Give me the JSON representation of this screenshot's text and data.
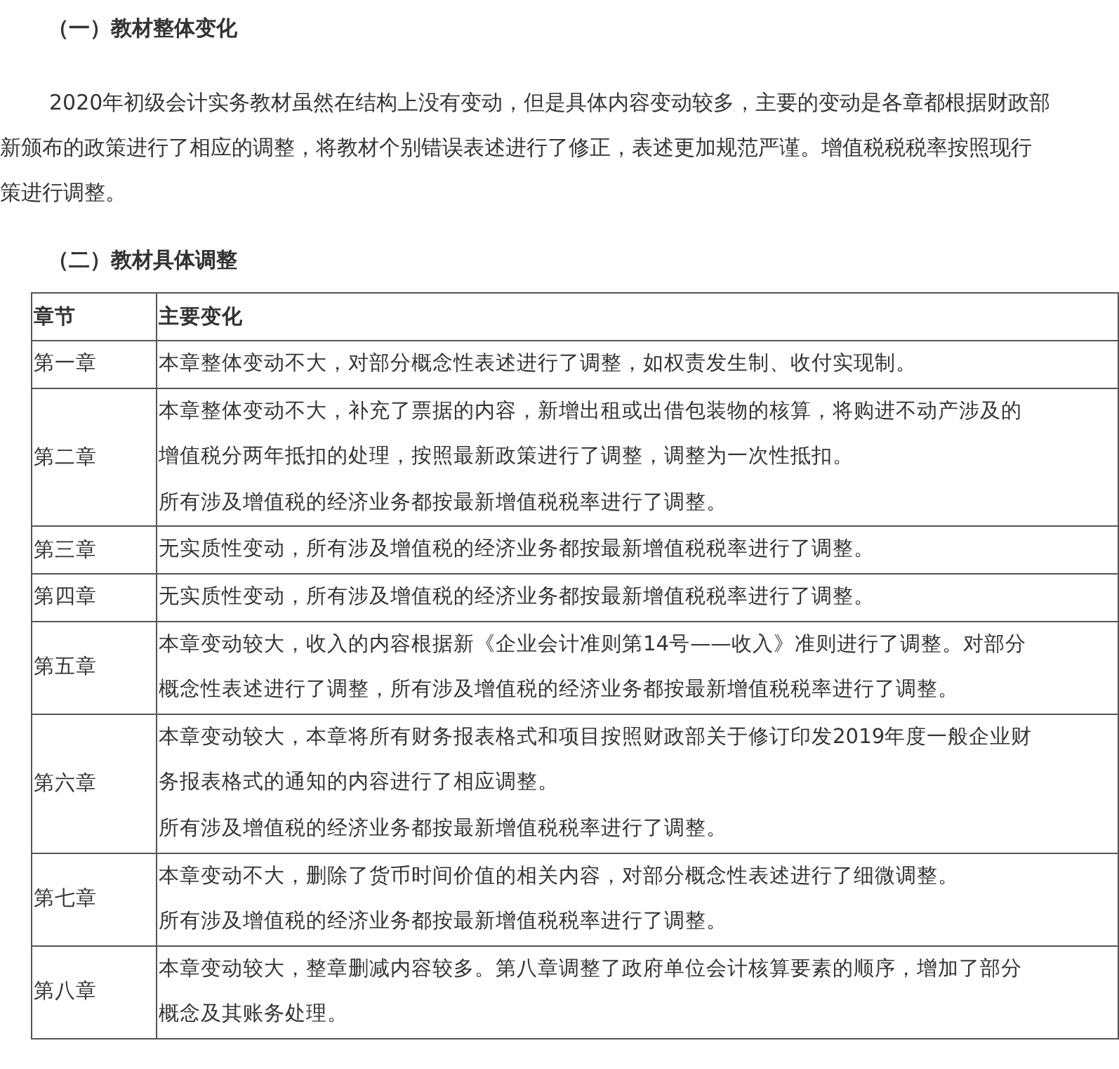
{
  "section_1": {
    "heading": "（一）教材整体变化",
    "paragraph_lines": [
      "2020年初级会计实务教材虽然在结构上没有变动，但是具体内容变动较多，主要的变动是各章都根据财政部",
      "新颁布的政策进行了相应的调整，将教材个别错误表述进行了修正，表述更加规范严谨。增值税税税率按照现行",
      "策进行调整。"
    ]
  },
  "section_2": {
    "heading": "（二）教材具体调整",
    "table": {
      "columns": [
        "章节",
        "主要变化"
      ],
      "rows": [
        {
          "chapter": "第一章",
          "lines": [
            "本章整体变动不大，对部分概念性表述进行了调整，如权责发生制、收付实现制。"
          ]
        },
        {
          "chapter": "第二章",
          "lines": [
            "本章整体变动不大，补充了票据的内容，新增出租或出借包装物的核算，将购进不动产涉及的",
            "增值税分两年抵扣的处理，按照最新政策进行了调整，调整为一次性抵扣。",
            "所有涉及增值税的经济业务都按最新增值税税率进行了调整。"
          ]
        },
        {
          "chapter": "第三章",
          "lines": [
            "无实质性变动，所有涉及增值税的经济业务都按最新增值税税率进行了调整。"
          ]
        },
        {
          "chapter": "第四章",
          "lines": [
            "无实质性变动，所有涉及增值税的经济业务都按最新增值税税率进行了调整。"
          ]
        },
        {
          "chapter": "第五章",
          "lines": [
            "本章变动较大，收入的内容根据新《企业会计准则第14号——收入》准则进行了调整。对部分",
            "概念性表述进行了调整，所有涉及增值税的经济业务都按最新增值税税率进行了调整。"
          ]
        },
        {
          "chapter": "第六章",
          "lines": [
            "本章变动较大，本章将所有财务报表格式和项目按照财政部关于修订印发2019年度一般企业财",
            "务报表格式的通知的内容进行了相应调整。",
            "所有涉及增值税的经济业务都按最新增值税税率进行了调整。"
          ]
        },
        {
          "chapter": "第七章",
          "lines": [
            "本章变动不大，删除了货币时间价值的相关内容，对部分概念性表述进行了细微调整。",
            "所有涉及增值税的经济业务都按最新增值税税率进行了调整。"
          ]
        },
        {
          "chapter": "第八章",
          "lines": [
            "本章变动较大，整章删减内容较多。第八章调整了政府单位会计核算要素的顺序，增加了部分",
            "概念及其账务处理。"
          ]
        }
      ]
    }
  }
}
